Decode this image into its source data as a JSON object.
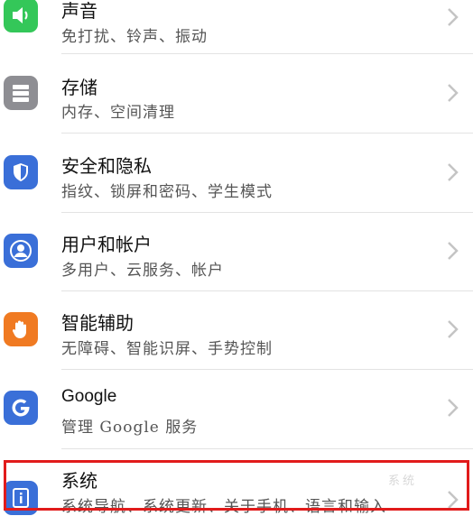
{
  "colors": {
    "sound_icon": "#34c759",
    "storage_icon": "#8e8e93",
    "security_icon": "#3a6fd8",
    "users_icon": "#3a6fd8",
    "assist_icon": "#f07a22",
    "google_icon": "#3a6fd8",
    "system_icon": "#3a6fd8",
    "highlight": "#e11b1b"
  },
  "settings": [
    {
      "title": "声音",
      "subtitle": "免打扰、铃声、振动",
      "icon": "speaker-icon"
    },
    {
      "title": "存储",
      "subtitle": "内存、空间清理",
      "icon": "storage-icon"
    },
    {
      "title": "安全和隐私",
      "subtitle": "指纹、锁屏和密码、学生模式",
      "icon": "shield-icon"
    },
    {
      "title": "用户和帐户",
      "subtitle": "多用户、云服务、帐户",
      "icon": "user-icon"
    },
    {
      "title": "智能辅助",
      "subtitle": "无障碍、智能识屏、手势控制",
      "icon": "hand-icon"
    },
    {
      "title": "Google",
      "subtitle": "管理 Google 服务",
      "icon": "google-icon"
    },
    {
      "title": "系统",
      "subtitle": "系统导航、系统更新、关于手机、语言和输入",
      "icon": "system-info-icon"
    }
  ],
  "watermark": "系统"
}
